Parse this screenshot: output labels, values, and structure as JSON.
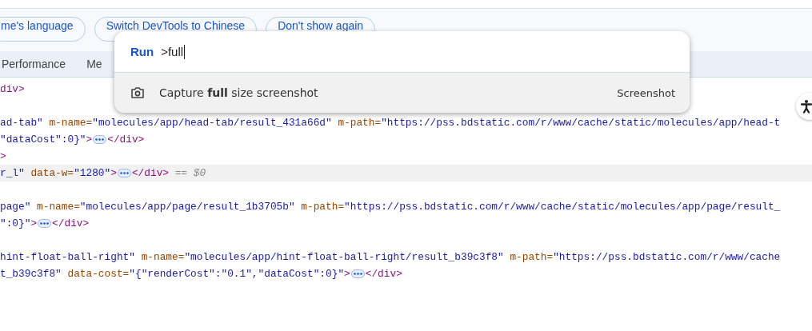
{
  "infobar": {
    "buttons": [
      "me's language",
      "Switch DevTools to Chinese",
      "Don't show again"
    ]
  },
  "tabs": [
    {
      "label": "Performance"
    },
    {
      "label": "Me"
    }
  ],
  "elements": [
    {
      "highlighted": false,
      "segments": [
        {
          "kind": "code",
          "tokens": [
            {
              "kind": "tag",
              "text": "div>"
            }
          ]
        }
      ]
    },
    {
      "highlighted": false,
      "blank_before": true,
      "segments": [
        {
          "kind": "code",
          "tokens": [
            {
              "kind": "value",
              "text": "ad-tab\""
            },
            {
              "kind": "attr",
              "text": " m-name="
            },
            {
              "kind": "value",
              "text": "\"molecules/app/head-tab/result_431a66d\""
            },
            {
              "kind": "attr",
              "text": " m-path="
            },
            {
              "kind": "value",
              "text": "\"https://pss.bdstatic.com/r/www/cache/static/molecules/app/head-t"
            }
          ]
        }
      ]
    },
    {
      "highlighted": false,
      "segments": [
        {
          "kind": "code",
          "tokens": [
            {
              "kind": "value",
              "text": "\"dataCost\":0}\""
            },
            {
              "kind": "tag",
              "text": ">"
            }
          ]
        },
        {
          "kind": "expand"
        },
        {
          "kind": "code",
          "tokens": [
            {
              "kind": "tag",
              "text": "</div>"
            }
          ]
        }
      ]
    },
    {
      "highlighted": false,
      "segments": [
        {
          "kind": "code",
          "tokens": [
            {
              "kind": "tag",
              "text": ">"
            }
          ]
        }
      ]
    },
    {
      "highlighted": true,
      "segments": [
        {
          "kind": "code",
          "tokens": [
            {
              "kind": "value",
              "text": "r_l\""
            },
            {
              "kind": "attr",
              "text": " data-w="
            },
            {
              "kind": "value",
              "text": "\"1280\""
            },
            {
              "kind": "tag",
              "text": ">"
            }
          ]
        },
        {
          "kind": "expand"
        },
        {
          "kind": "code",
          "tokens": [
            {
              "kind": "tag",
              "text": "</div>"
            },
            {
              "kind": "comment",
              "text": " == $0"
            }
          ]
        }
      ]
    },
    {
      "highlighted": false,
      "blank_before": true,
      "segments": [
        {
          "kind": "code",
          "tokens": [
            {
              "kind": "value",
              "text": "page\""
            },
            {
              "kind": "attr",
              "text": " m-name="
            },
            {
              "kind": "value",
              "text": "\"molecules/app/page/result_1b3705b\""
            },
            {
              "kind": "attr",
              "text": " m-path="
            },
            {
              "kind": "value",
              "text": "\"https://pss.bdstatic.com/r/www/cache/static/molecules/app/page/result_"
            }
          ]
        }
      ]
    },
    {
      "highlighted": false,
      "segments": [
        {
          "kind": "code",
          "tokens": [
            {
              "kind": "value",
              "text": "\":0}\""
            },
            {
              "kind": "tag",
              "text": ">"
            }
          ]
        },
        {
          "kind": "expand"
        },
        {
          "kind": "code",
          "tokens": [
            {
              "kind": "tag",
              "text": "</div>"
            }
          ]
        }
      ]
    },
    {
      "highlighted": false,
      "blank_before": true,
      "segments": [
        {
          "kind": "code",
          "tokens": [
            {
              "kind": "value",
              "text": "hint-float-ball-right\""
            },
            {
              "kind": "attr",
              "text": " m-name="
            },
            {
              "kind": "value",
              "text": "\"molecules/app/hint-float-ball-right/result_b39c3f8\""
            },
            {
              "kind": "attr",
              "text": " m-path="
            },
            {
              "kind": "value",
              "text": "\"https://pss.bdstatic.com/r/www/cache"
            }
          ]
        }
      ]
    },
    {
      "highlighted": false,
      "segments": [
        {
          "kind": "code",
          "tokens": [
            {
              "kind": "value",
              "text": "t_b39c3f8\""
            },
            {
              "kind": "attr",
              "text": " data-cost="
            },
            {
              "kind": "value",
              "text": "\"{\"renderCost\":\"0.1\",\"dataCost\":0}\""
            },
            {
              "kind": "tag",
              "text": ">"
            }
          ]
        },
        {
          "kind": "expand"
        },
        {
          "kind": "code",
          "tokens": [
            {
              "kind": "tag",
              "text": "</div>"
            }
          ]
        }
      ]
    }
  ],
  "command_menu": {
    "prefix": "Run",
    "query": ">full",
    "results": [
      {
        "label": "Capture **full** size screenshot",
        "category": "Screenshot",
        "selected": true
      }
    ]
  }
}
